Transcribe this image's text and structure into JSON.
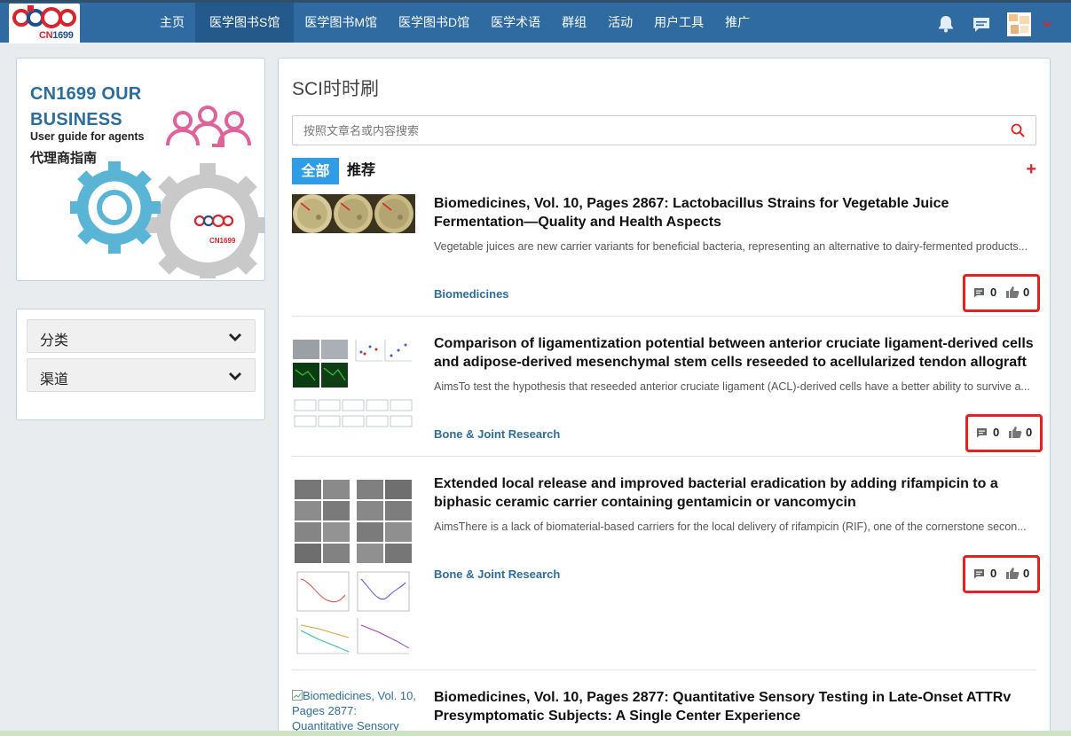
{
  "logo": {
    "text_red": "CN",
    "text_blue": "1699"
  },
  "nav": {
    "items": [
      {
        "label": "主页",
        "active": false
      },
      {
        "label": "医学图书S馆",
        "active": true
      },
      {
        "label": "医学图书M馆",
        "active": false
      },
      {
        "label": "医学图书D馆",
        "active": false
      },
      {
        "label": "医学术语",
        "active": false
      },
      {
        "label": "群组",
        "active": false
      },
      {
        "label": "活动",
        "active": false
      },
      {
        "label": "用户工具",
        "active": false
      },
      {
        "label": "推广",
        "active": false
      }
    ]
  },
  "ad": {
    "title_line1": "CN1699 OUR",
    "title_line2": "BUSINESS",
    "subtitle": "User guide for agents",
    "subtitle_cn": "代理商指南",
    "brand": "CN1699"
  },
  "sidebar": {
    "accordions": [
      {
        "label": "分类"
      },
      {
        "label": "渠道"
      }
    ]
  },
  "main": {
    "title": "SCI时时刷",
    "search_placeholder": "按照文章名或内容搜索",
    "tabs": [
      {
        "label": "全部"
      },
      {
        "label": "推荐"
      }
    ],
    "add_label": "+"
  },
  "articles": [
    {
      "title": "Biomedicines, Vol. 10, Pages 2867: Lactobacillus Strains for Vegetable Juice Fermentation—Quality and Health Aspects",
      "desc": "Vegetable juices are new carrier variants for beneficial bacteria, representing an alternative to dairy-fermented products...",
      "source": "Biomedicines",
      "comments": "0",
      "likes": "0"
    },
    {
      "title": "Comparison of ligamentization potential between anterior cruciate ligament-derived cells and adipose-derived mesenchymal stem cells reseeded to acellularized tendon allograft",
      "desc": "AimsTo test the hypothesis that reseeded anterior cruciate ligament (ACL)-derived cells have a better ability to survive a...",
      "source": "Bone & Joint Research",
      "comments": "0",
      "likes": "0"
    },
    {
      "title": "Extended local release and improved bacterial eradication by adding rifampicin to a biphasic ceramic carrier containing gentamicin or vancomycin",
      "desc": "AimsThere is a lack of biomaterial-based carriers for the local delivery of rifampicin (RIF), one of the cornerstone secon...",
      "source": "Bone & Joint Research",
      "comments": "0",
      "likes": "0"
    },
    {
      "title": "Biomedicines, Vol. 10, Pages 2877: Quantitative Sensory Testing in Late-Onset ATTRv Presymptomatic Subjects: A Single Center Experience",
      "image_alt": "Biomedicines, Vol. 10, Pages 2877: Quantitative Sensory"
    }
  ],
  "colors": {
    "nav_bg": "#2f6aa0",
    "accent": "#2e9ce6",
    "highlight_red": "#e8201f",
    "link": "#2d6d9c"
  },
  "icons": {
    "notifications": "bell-icon",
    "messages": "chat-icon",
    "search": "search-icon",
    "comments": "comment-icon",
    "likes": "thumbs-up-icon",
    "expand": "chevron-down-icon"
  }
}
